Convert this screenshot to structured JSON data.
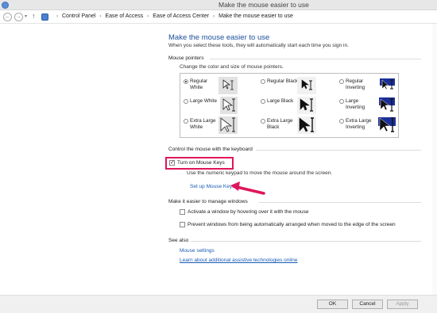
{
  "window": {
    "title": "Make the mouse easier to use"
  },
  "address": {
    "crumbs": [
      "Control Panel",
      "Ease of Access",
      "Ease of Access Center",
      "Make the mouse easier to use"
    ],
    "icons": {
      "back": "back-arrow-icon",
      "forward": "forward-arrow-icon",
      "up": "up-arrow-icon"
    }
  },
  "page": {
    "heading": "Make the mouse easier to use",
    "subheading": "When you select these tools, they will automatically start each time you sign in."
  },
  "pointers": {
    "section_title": "Mouse pointers",
    "hint": "Change the color and size of mouse pointers.",
    "options": [
      {
        "label": "Regular White",
        "selected": true
      },
      {
        "label": "Regular Black",
        "selected": false
      },
      {
        "label": "Regular Inverting",
        "selected": false
      },
      {
        "label": "Large White",
        "selected": false
      },
      {
        "label": "Large Black",
        "selected": false
      },
      {
        "label": "Large Inverting",
        "selected": false
      },
      {
        "label": "Extra Large White",
        "selected": false
      },
      {
        "label": "Extra Large Black",
        "selected": false
      },
      {
        "label": "Extra Large Inverting",
        "selected": false
      }
    ]
  },
  "keyboard": {
    "section_title": "Control the mouse with the keyboard",
    "mouse_keys_label": "Turn on Mouse Keys",
    "mouse_keys_checked": true,
    "mouse_keys_desc": "Use the numeric keypad to move the mouse around the screen.",
    "setup_link": "Set up Mouse Keys"
  },
  "windows": {
    "section_title": "Make it easier to manage windows",
    "hover_label": "Activate a window by hovering over it with the mouse",
    "arrange_label": "Prevent windows from being automatically arranged when moved to the edge of the screen"
  },
  "see_also": {
    "section_title": "See also",
    "links": [
      "Mouse settings",
      "Learn about additional assistive technologies online"
    ]
  },
  "buttons": {
    "ok": "OK",
    "cancel": "Cancel",
    "apply": "Apply"
  },
  "colors": {
    "heading": "#1b4f9a",
    "link": "#1a5bb5",
    "highlight": "#e0165c",
    "inverting_bg": "#1b2f9a"
  }
}
